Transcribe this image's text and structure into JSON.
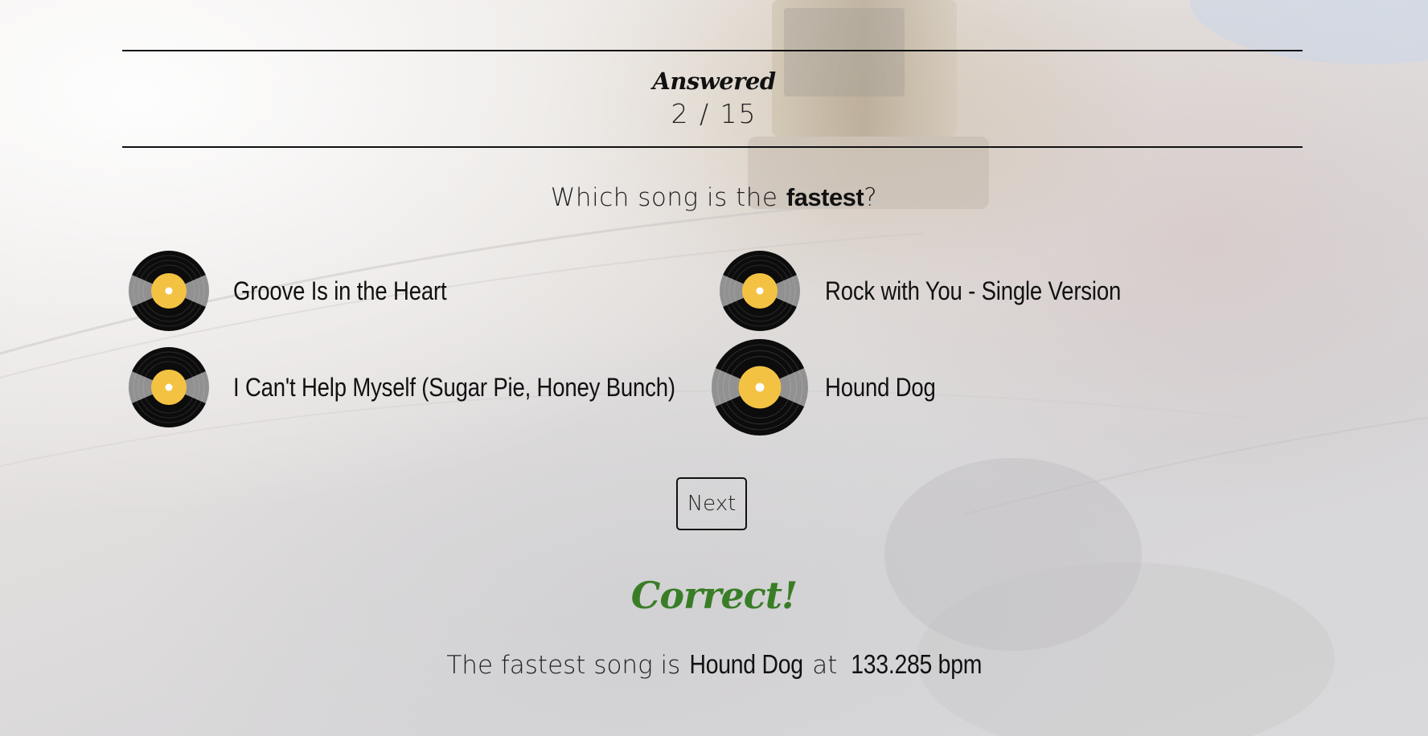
{
  "progress": {
    "label": "Answered",
    "count_text": "2 / 15"
  },
  "question": {
    "prefix": "Which song is the ",
    "emphasis": "fastest",
    "suffix": "?"
  },
  "options": [
    {
      "label": "Groove Is in the Heart",
      "icon": "vinyl-record-icon"
    },
    {
      "label": "Rock with You - Single Version",
      "icon": "vinyl-record-icon"
    },
    {
      "label": "I Can't Help Myself (Sugar Pie, Honey Bunch)",
      "icon": "vinyl-record-icon"
    },
    {
      "label": "Hound Dog",
      "icon": "vinyl-record-icon",
      "selected": true
    }
  ],
  "next_label": "Next",
  "result": {
    "title": "Correct!",
    "line_prefix": "The fastest song is ",
    "song": "Hound Dog",
    "line_middle": " at ",
    "value": "133.285 bpm"
  },
  "colors": {
    "correct": "#3a7d27",
    "vinyl_label": "#f4c242",
    "vinyl": "#0c0c0c"
  }
}
